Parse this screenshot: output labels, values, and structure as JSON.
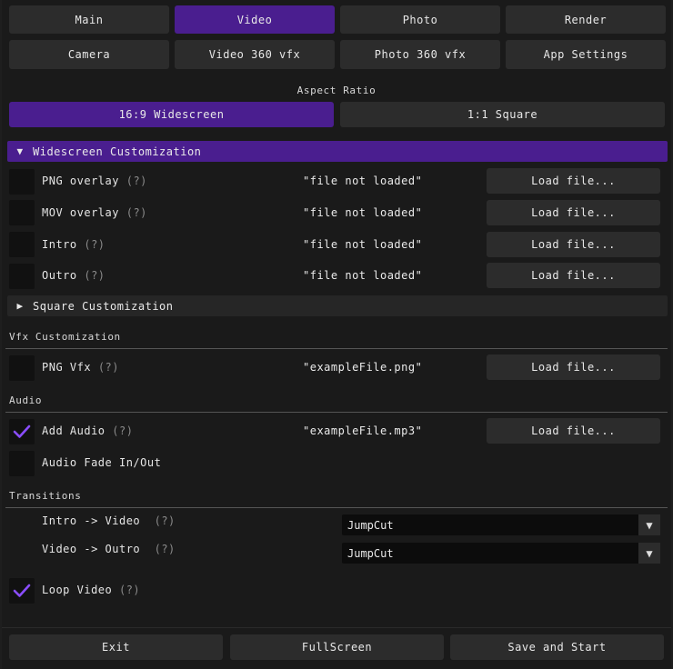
{
  "tabs_row1": [
    {
      "label": "Main"
    },
    {
      "label": "Video"
    },
    {
      "label": "Photo"
    },
    {
      "label": "Render"
    }
  ],
  "tabs_row2": [
    {
      "label": "Camera"
    },
    {
      "label": "Video 360 vfx"
    },
    {
      "label": "Photo 360 vfx"
    },
    {
      "label": "App Settings"
    }
  ],
  "active_tab": "Video",
  "aspect": {
    "title": "Aspect Ratio",
    "options": [
      "16:9 Widescreen",
      "1:1 Square"
    ],
    "selected": "16:9 Widescreen"
  },
  "widescreen": {
    "header": "Widescreen Customization",
    "expanded": true,
    "rows": [
      {
        "label": "PNG overlay",
        "help": "(?)",
        "file": "\"file not loaded\"",
        "button": "Load file...",
        "checked": false
      },
      {
        "label": "MOV overlay",
        "help": "(?)",
        "file": "\"file not loaded\"",
        "button": "Load file...",
        "checked": false
      },
      {
        "label": "Intro",
        "help": "(?)",
        "file": "\"file not loaded\"",
        "button": "Load file...",
        "checked": false
      },
      {
        "label": "Outro",
        "help": "(?)",
        "file": "\"file not loaded\"",
        "button": "Load file...",
        "checked": false
      }
    ]
  },
  "square": {
    "header": "Square Customization",
    "expanded": false
  },
  "vfx": {
    "title": "Vfx Customization",
    "row": {
      "label": "PNG Vfx",
      "help": "(?)",
      "file": "\"exampleFile.png\"",
      "button": "Load file...",
      "checked": false
    }
  },
  "audio": {
    "title": "Audio",
    "add": {
      "label": "Add Audio",
      "help": "(?)",
      "file": "\"exampleFile.mp3\"",
      "button": "Load file...",
      "checked": true
    },
    "fade": {
      "label": "Audio Fade In/Out",
      "checked": false
    }
  },
  "transitions": {
    "title": "Transitions",
    "items": [
      {
        "label": "Intro -> Video",
        "help": "(?)",
        "value": "JumpCut"
      },
      {
        "label": "Video -> Outro",
        "help": "(?)",
        "value": "JumpCut"
      }
    ],
    "loop": {
      "label": "Loop Video",
      "help": "(?)",
      "checked": true
    }
  },
  "footer": {
    "exit": "Exit",
    "fullscreen": "FullScreen",
    "save": "Save and Start"
  },
  "colors": {
    "accent": "#4a1e8f",
    "check": "#8a4dff"
  }
}
